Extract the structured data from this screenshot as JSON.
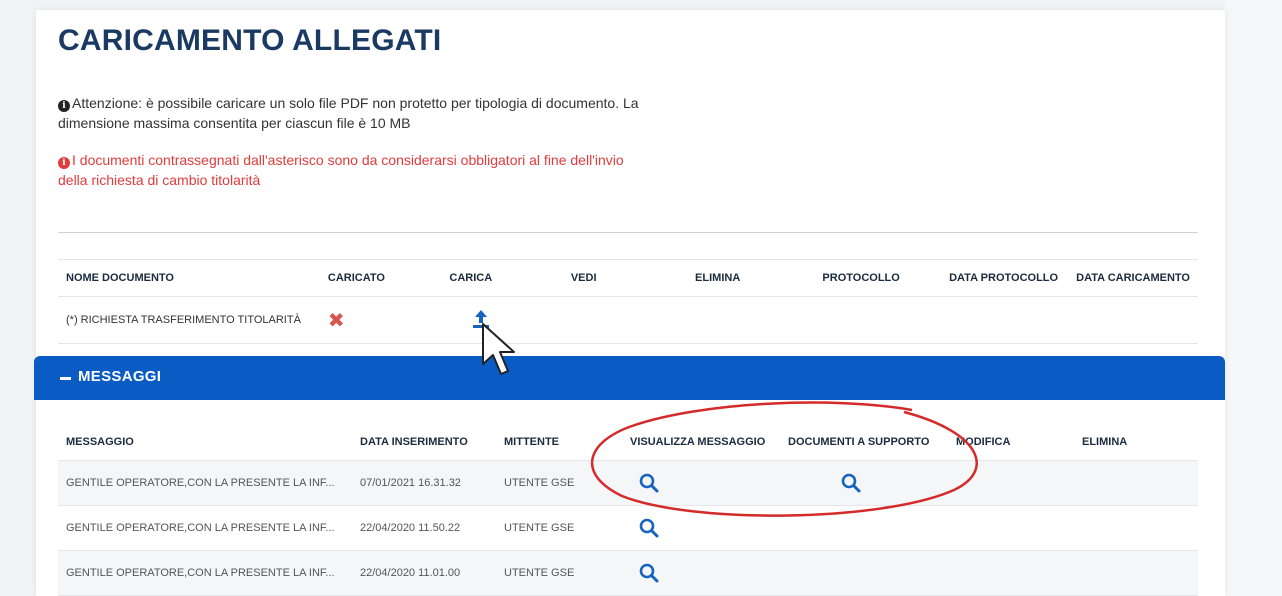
{
  "page": {
    "title": "CARICAMENTO ALLEGATI",
    "notes": {
      "info": "Attenzione: è possibile caricare un solo file PDF non protetto per tipologia di documento. La dimensione massima consentita per ciascun file è 10 MB",
      "warning": "I documenti contrassegnati dall'asterisco sono da considerarsi obbligatori al fine dell'invio della richiesta di cambio titolarità"
    }
  },
  "documents": {
    "headers": {
      "nome": "NOME DOCUMENTO",
      "caricato": "CARICATO",
      "carica": "CARICA",
      "vedi": "VEDI",
      "elimina": "ELIMINA",
      "protocollo": "PROTOCOLLO",
      "data_protocollo": "DATA PROTOCOLLO",
      "data_caricamento": "DATA CARICAMENTO"
    },
    "rows": [
      {
        "nome": "(*) RICHIESTA TRASFERIMENTO TITOLARITÀ",
        "caricato_icon": "x-icon",
        "carica_icon": "upload-icon"
      }
    ]
  },
  "messages": {
    "section_title": "MESSAGGI",
    "headers": {
      "messaggio": "MESSAGGIO",
      "data": "DATA INSERIMENTO",
      "mittente": "MITTENTE",
      "visualizza": "VISUALIZZA MESSAGGIO",
      "documenti": "DOCUMENTI A SUPPORTO",
      "modifica": "MODIFICA",
      "elimina": "ELIMINA"
    },
    "rows": [
      {
        "messaggio": "GENTILE OPERATORE,CON LA PRESENTE LA INF...",
        "data": "07/01/2021 16.31.32",
        "mittente": "UTENTE GSE"
      },
      {
        "messaggio": "GENTILE OPERATORE,CON LA PRESENTE LA INF...",
        "data": "22/04/2020 11.50.22",
        "mittente": "UTENTE GSE"
      },
      {
        "messaggio": "GENTILE OPERATORE,CON LA PRESENTE LA INF...",
        "data": "22/04/2020 11.01.00",
        "mittente": "UTENTE GSE"
      }
    ]
  },
  "colors": {
    "title": "#1a3a63",
    "header_bar": "#0a5bc4",
    "warning": "#e23b3b",
    "icon_blue": "#1565c0",
    "annotation": "#d42a2a"
  }
}
